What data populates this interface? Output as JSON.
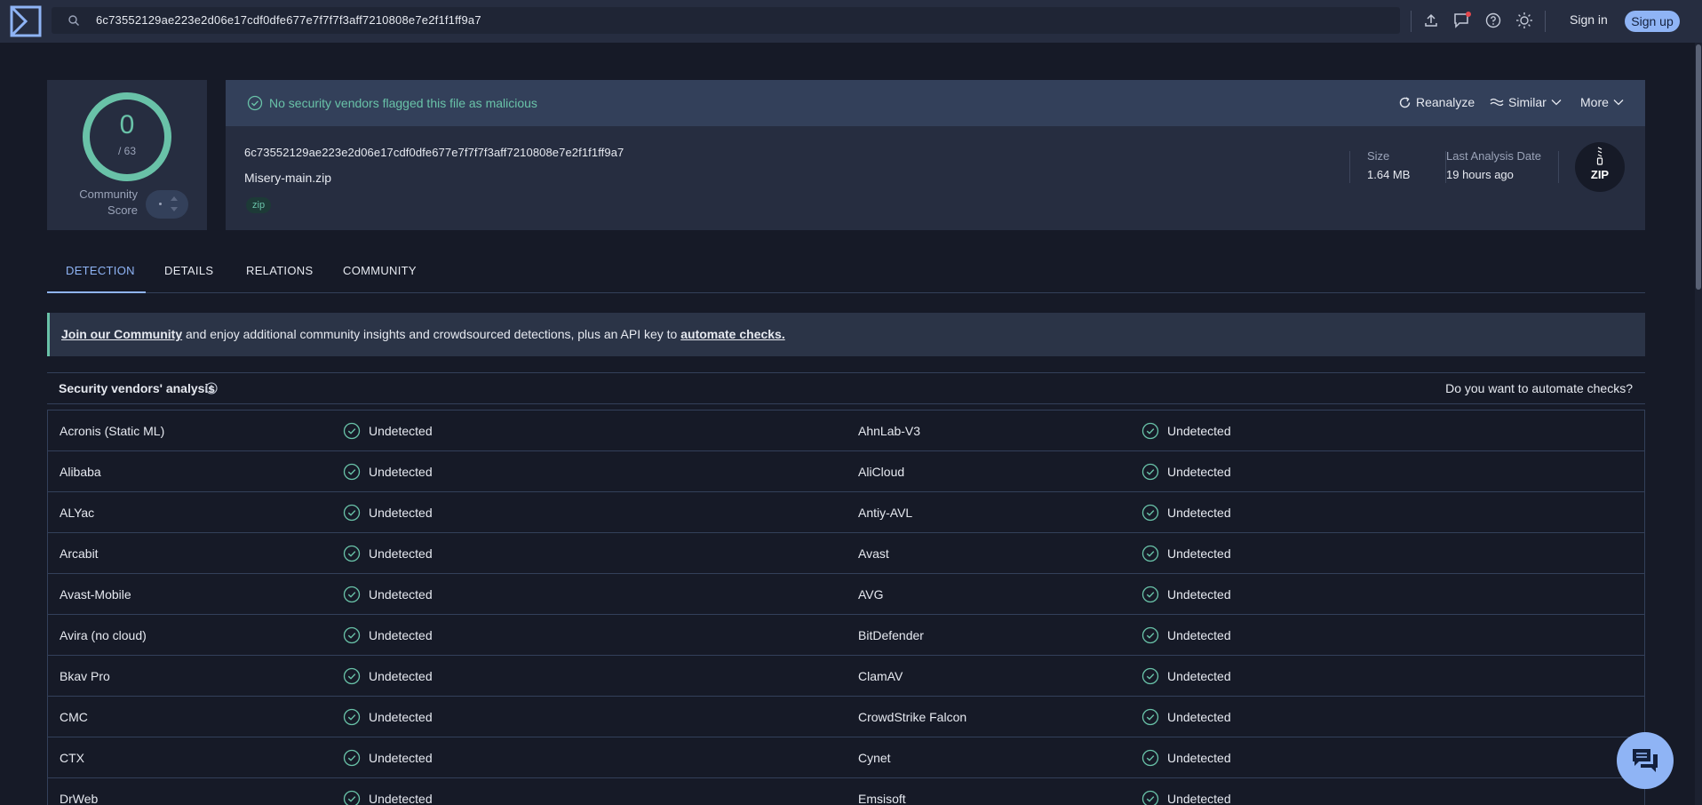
{
  "search": {
    "value": "6c73552129ae223e2d06e17cdf0dfe677e7f7f7f3aff7210808e7e2f1f1ff9a7"
  },
  "topbar": {
    "icons": [
      "upload-icon",
      "notifications-icon",
      "help-icon",
      "theme-icon"
    ],
    "signin_label": "Sign in",
    "signup_label": "Sign up"
  },
  "score": {
    "value": "0",
    "total": "/ 63",
    "community_label": "Community Score"
  },
  "file": {
    "verdict": "No security vendors flagged this file as malicious",
    "actions": {
      "reanalyze": "Reanalyze",
      "similar": "Similar",
      "more": "More"
    },
    "hash": "6c73552129ae223e2d06e17cdf0dfe677e7f7f7f3aff7210808e7e2f1f1ff9a7",
    "name": "Misery-main.zip",
    "tag": "zip",
    "size_label": "Size",
    "size_value": "1.64 MB",
    "date_label": "Last Analysis Date",
    "date_value": "19 hours ago",
    "type_badge": "ZIP"
  },
  "tabs": [
    "DETECTION",
    "DETAILS",
    "RELATIONS",
    "COMMUNITY"
  ],
  "banner": {
    "link1": "Join our Community",
    "middle": " and enjoy additional community insights and crowdsourced detections, plus an API key to ",
    "link2": "automate checks."
  },
  "vendors_header": {
    "title": "Security vendors' analysis",
    "automate": "Do you want to automate checks?"
  },
  "vendors": [
    {
      "left": "Acronis (Static ML)",
      "left_status": "Undetected",
      "right": "AhnLab-V3",
      "right_status": "Undetected"
    },
    {
      "left": "Alibaba",
      "left_status": "Undetected",
      "right": "AliCloud",
      "right_status": "Undetected"
    },
    {
      "left": "ALYac",
      "left_status": "Undetected",
      "right": "Antiy-AVL",
      "right_status": "Undetected"
    },
    {
      "left": "Arcabit",
      "left_status": "Undetected",
      "right": "Avast",
      "right_status": "Undetected"
    },
    {
      "left": "Avast-Mobile",
      "left_status": "Undetected",
      "right": "AVG",
      "right_status": "Undetected"
    },
    {
      "left": "Avira (no cloud)",
      "left_status": "Undetected",
      "right": "BitDefender",
      "right_status": "Undetected"
    },
    {
      "left": "Bkav Pro",
      "left_status": "Undetected",
      "right": "ClamAV",
      "right_status": "Undetected"
    },
    {
      "left": "CMC",
      "left_status": "Undetected",
      "right": "CrowdStrike Falcon",
      "right_status": "Undetected"
    },
    {
      "left": "CTX",
      "left_status": "Undetected",
      "right": "Cynet",
      "right_status": "Undetected"
    },
    {
      "left": "DrWeb",
      "left_status": "Undetected",
      "right": "Emsisoft",
      "right_status": "Undetected"
    }
  ],
  "colors": {
    "accent": "#8fb4f5",
    "clean": "#69c2a8",
    "background": "#161a27",
    "card": "#262d40",
    "notification_dot": "#e5484d"
  }
}
